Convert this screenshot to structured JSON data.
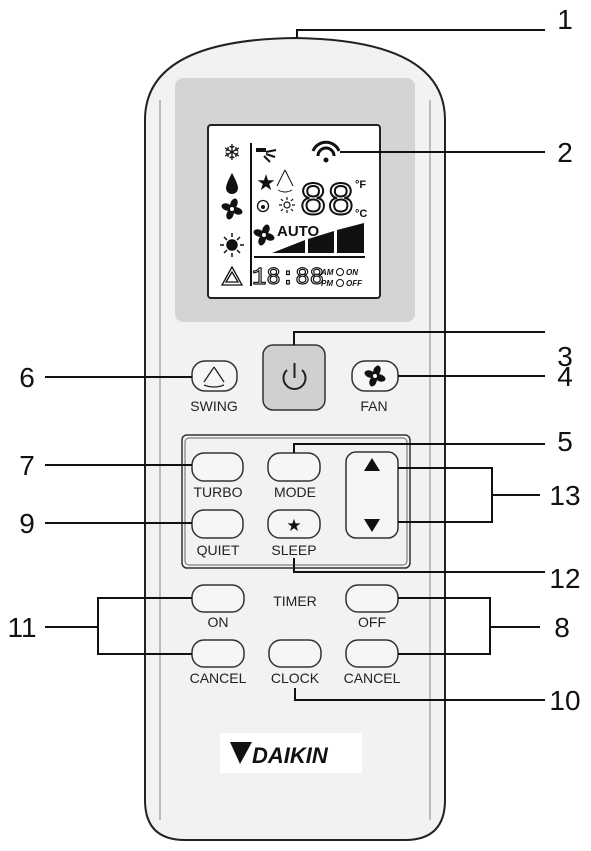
{
  "callouts": [
    "1",
    "2",
    "3",
    "4",
    "5",
    "6",
    "7",
    "8",
    "9",
    "10",
    "11",
    "12",
    "13"
  ],
  "display": {
    "temp_digits": "88",
    "unit_f": "°F",
    "unit_c": "°C",
    "fan_mode": "AUTO",
    "clock_digits": "18:88",
    "am": "AM",
    "pm": "PM",
    "timer_on": "ON",
    "timer_off": "OFF"
  },
  "buttons": {
    "swing": "SWING",
    "fan": "FAN",
    "turbo": "TURBO",
    "mode": "MODE",
    "quiet": "QUIET",
    "sleep": "SLEEP",
    "timer": "TIMER",
    "timer_on": "ON",
    "timer_off": "OFF",
    "cancel_on": "CANCEL",
    "clock": "CLOCK",
    "cancel_off": "CANCEL"
  },
  "brand": "DAIKIN",
  "colors": {
    "body": "#f2f2f2",
    "display_window": "#d4d4d4",
    "power_button": "#d0d0d0",
    "outline": "#222222"
  }
}
